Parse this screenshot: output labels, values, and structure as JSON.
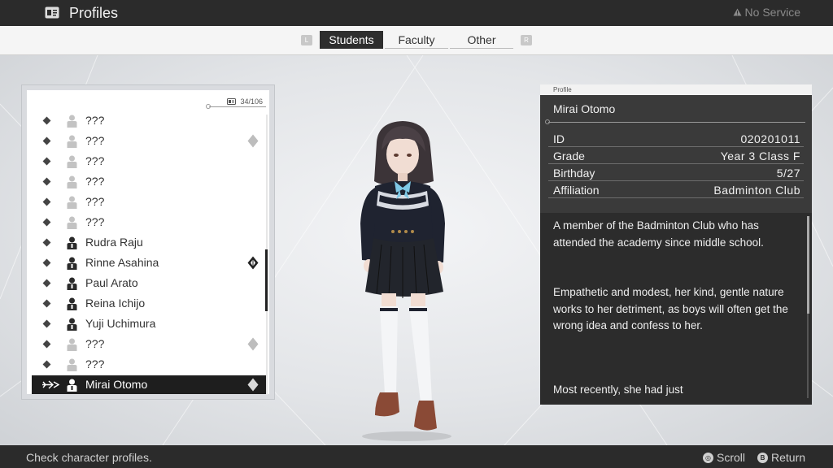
{
  "header": {
    "title": "Profiles",
    "network_status": "No Service",
    "icon": "id-card-icon"
  },
  "tabs": {
    "left_key": "L",
    "right_key": "R",
    "items": [
      {
        "label": "Students",
        "active": true
      },
      {
        "label": "Faculty",
        "active": false
      },
      {
        "label": "Other",
        "active": false
      }
    ]
  },
  "list": {
    "counter": "34/106",
    "rows": [
      {
        "name": "???",
        "known": false,
        "mark": "none"
      },
      {
        "name": "???",
        "known": false,
        "mark": "diamond"
      },
      {
        "name": "???",
        "known": false,
        "mark": "none"
      },
      {
        "name": "???",
        "known": false,
        "mark": "none"
      },
      {
        "name": "???",
        "known": false,
        "mark": "none"
      },
      {
        "name": "???",
        "known": false,
        "mark": "none"
      },
      {
        "name": "Rudra Raju",
        "known": true,
        "mark": "none"
      },
      {
        "name": "Rinne Asahina",
        "known": true,
        "mark": "crest"
      },
      {
        "name": "Paul Arato",
        "known": true,
        "mark": "none"
      },
      {
        "name": "Reina Ichijo",
        "known": true,
        "mark": "none"
      },
      {
        "name": "Yuji Uchimura",
        "known": true,
        "mark": "none"
      },
      {
        "name": "???",
        "known": false,
        "mark": "diamond"
      },
      {
        "name": "???",
        "known": false,
        "mark": "none"
      },
      {
        "name": "Mirai Otomo",
        "known": true,
        "mark": "diamond",
        "selected": true
      }
    ]
  },
  "profile": {
    "header_label": "Profile",
    "name": "Mirai Otomo",
    "fields": [
      {
        "key": "ID",
        "value": "020201011"
      },
      {
        "key": "Grade",
        "value": "Year 3 Class F"
      },
      {
        "key": "Birthday",
        "value": "5/27"
      },
      {
        "key": "Affiliation",
        "value": "Badminton Club"
      }
    ],
    "description": [
      "A member of the Badminton Club who has attended the academy since middle school.",
      "Empathetic and modest, her kind, gentle nature works to her detriment, as boys will often get the wrong idea and confess to her.",
      "Most recently, she had just"
    ]
  },
  "footer": {
    "hint": "Check character profiles.",
    "scroll_label": "Scroll",
    "return_label": "Return"
  },
  "colors": {
    "bar": "#2b2b2b",
    "panel_dark": "#3a3a3a",
    "selected_row": "#1e1e1e"
  }
}
